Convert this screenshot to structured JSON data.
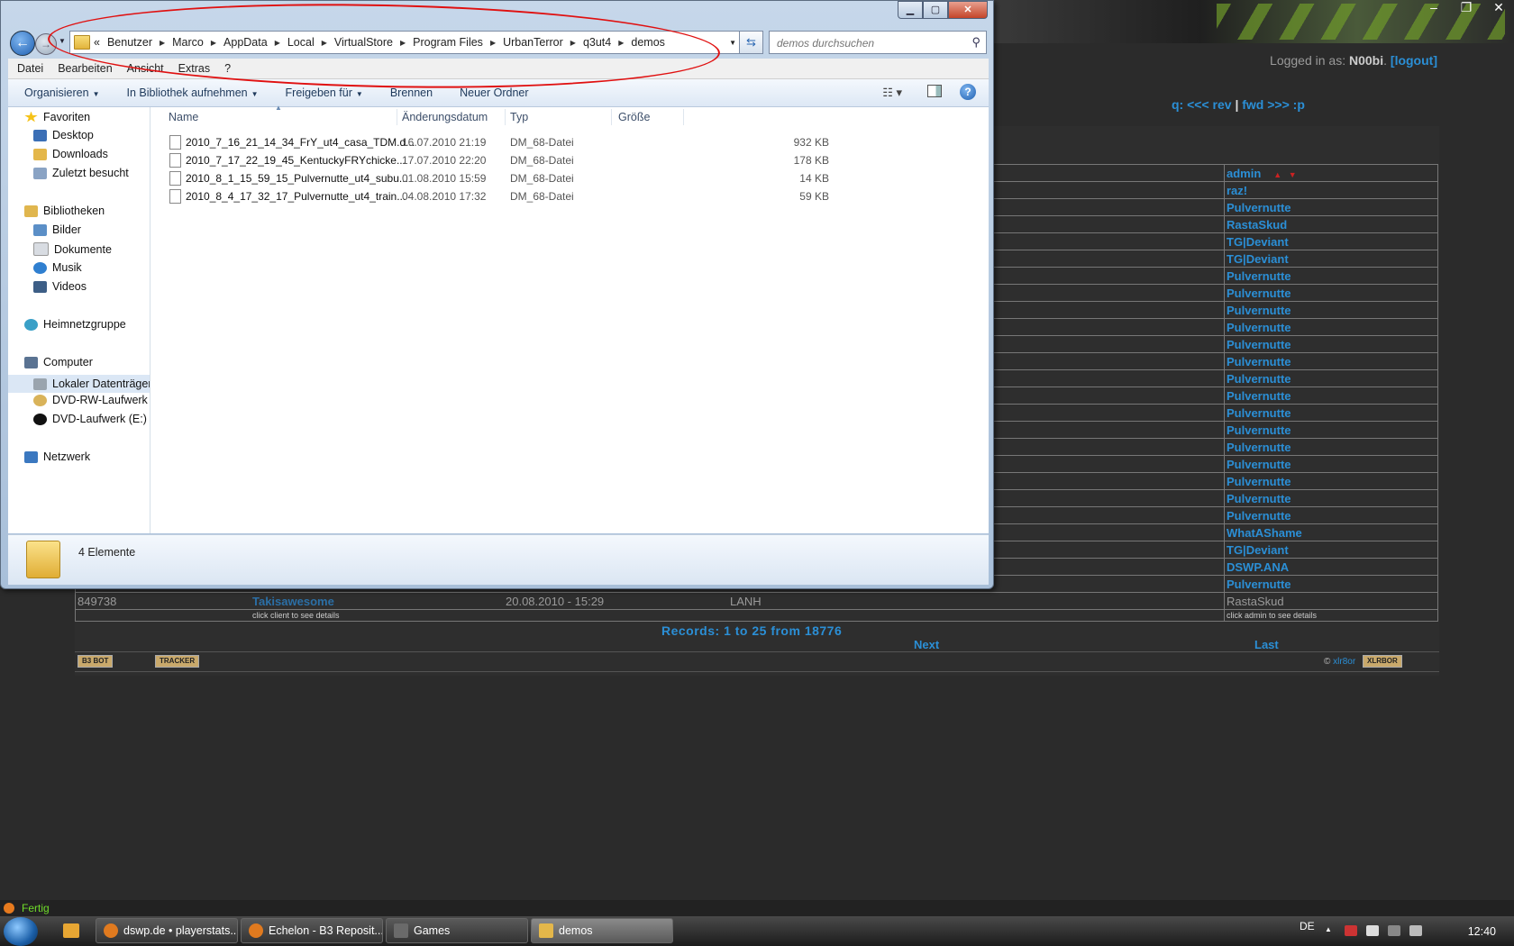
{
  "browser_page": {
    "login_prefix": "Logged in as:",
    "login_user": "N00bi",
    "logout": "[logout]",
    "qnav_label": "q: <<< rev",
    "qnav_sep": "|",
    "qnav_fwd": "fwd >>> :p",
    "admin_header": "admin",
    "admins": [
      "raz!",
      "Pulvernutte",
      "RastaSkud",
      "TG|Deviant",
      "TG|Deviant",
      "Pulvernutte",
      "Pulvernutte",
      "Pulvernutte",
      "Pulvernutte",
      "Pulvernutte",
      "Pulvernutte",
      "Pulvernutte",
      "Pulvernutte",
      "Pulvernutte",
      "Pulvernutte",
      "Pulvernutte",
      "Pulvernutte",
      "Pulvernutte",
      "Pulvernutte",
      "Pulvernutte",
      "WhatAShame",
      "TG|Deviant",
      "DSWP.ANA",
      "Pulvernutte"
    ],
    "last_row": {
      "id": "849738",
      "player": "Takisawesome",
      "date": "20.08.2010 - 15:29",
      "type": "LANH",
      "admin": "RastaSkud"
    },
    "hint_client": "click client to see details",
    "hint_admin": "click admin to see details",
    "records": "Records: 1 to 25 from 18776",
    "next": "Next",
    "last": "Last",
    "badge_b3": "B3 BOT",
    "badge_tracker": "TRACKER",
    "badge_xlrbor": "XLRBOR",
    "copyright_sym": "©",
    "copyright_link": "xlr8or"
  },
  "explorer": {
    "breadcrumb": [
      "«",
      "Benutzer",
      "Marco",
      "AppData",
      "Local",
      "VirtualStore",
      "Program Files",
      "UrbanTerror",
      "q3ut4",
      "demos"
    ],
    "search_placeholder": "demos durchsuchen",
    "menu": [
      "Datei",
      "Bearbeiten",
      "Ansicht",
      "Extras",
      "?"
    ],
    "commands": {
      "organize": "Organisieren",
      "library": "In Bibliothek aufnehmen",
      "share": "Freigeben für",
      "burn": "Brennen",
      "new_folder": "Neuer Ordner"
    },
    "nav": {
      "favorites": "Favoriten",
      "desktop": "Desktop",
      "downloads": "Downloads",
      "recent": "Zuletzt besucht",
      "libraries": "Bibliotheken",
      "pictures": "Bilder",
      "documents": "Dokumente",
      "music": "Musik",
      "videos": "Videos",
      "homegroup": "Heimnetzgruppe",
      "computer": "Computer",
      "local_disk": "Lokaler Datenträger",
      "dvd_rw": "DVD-RW-Laufwerk (",
      "dvd": "DVD-Laufwerk (E:) S",
      "network": "Netzwerk"
    },
    "columns": {
      "name": "Name",
      "date": "Änderungsdatum",
      "type": "Typ",
      "size": "Größe"
    },
    "files": [
      {
        "name": "2010_7_16_21_14_34_FrY_ut4_casa_TDM.d...",
        "date": "16.07.2010 21:19",
        "type": "DM_68-Datei",
        "size": "932 KB"
      },
      {
        "name": "2010_7_17_22_19_45_KentuckyFRYchicke...",
        "date": "17.07.2010 22:20",
        "type": "DM_68-Datei",
        "size": "178 KB"
      },
      {
        "name": "2010_8_1_15_59_15_Pulvernutte_ut4_subu...",
        "date": "01.08.2010 15:59",
        "type": "DM_68-Datei",
        "size": "14 KB"
      },
      {
        "name": "2010_8_4_17_32_17_Pulvernutte_ut4_train...",
        "date": "04.08.2010 17:32",
        "type": "DM_68-Datei",
        "size": "59 KB"
      }
    ],
    "item_count": "4 Elemente"
  },
  "status": {
    "text": "Fertig"
  },
  "taskbar": {
    "tasks": [
      "dswp.de • playerstats...",
      "Echelon - B3 Reposit...",
      "Games",
      "demos"
    ],
    "lang": "DE",
    "clock": "12:40"
  },
  "colors": {
    "link": "#2b8fd6",
    "annotation": "#e01010",
    "status_green": "#6fdc2a"
  }
}
